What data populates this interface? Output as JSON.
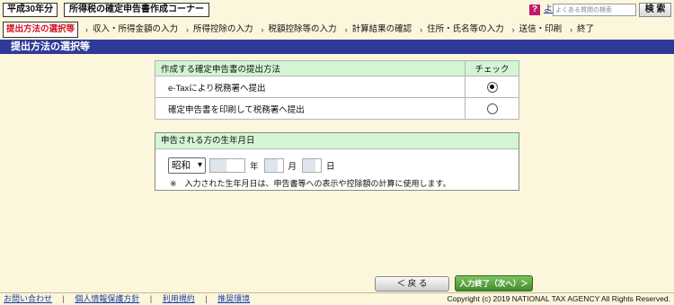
{
  "header": {
    "year_label": "平成30年分",
    "title": "所得税の確定申告書作成コーナー",
    "help_icon_glyph": "?",
    "faq_link": "よくある質問",
    "faq_search_placeholder": "よくある質問の検索",
    "search_button": "検 索"
  },
  "steps": [
    {
      "label": "提出方法の選択等",
      "current": true
    },
    {
      "label": "収入・所得金額の入力"
    },
    {
      "label": "所得控除の入力"
    },
    {
      "label": "税額控除等の入力"
    },
    {
      "label": "計算結果の確認"
    },
    {
      "label": "住所・氏名等の入力"
    },
    {
      "label": "送信・印刷"
    },
    {
      "label": "終了"
    }
  ],
  "section_title": "提出方法の選択等",
  "method_table": {
    "header_method": "作成する確定申告書の提出方法",
    "header_check": "チェック",
    "rows": [
      {
        "label": "e-Taxにより税務署へ提出",
        "selected": true
      },
      {
        "label": "確定申告書を印刷して税務署へ提出",
        "selected": false
      }
    ]
  },
  "birth": {
    "header": "申告される方の生年月日",
    "era_value": "昭和",
    "year_unit": "年",
    "month_unit": "月",
    "day_unit": "日",
    "note": "※　入力された生年月日は、申告書等への表示や控除額の計算に使用します。"
  },
  "buttons": {
    "back": "＜  戻 る",
    "next": "入力終了（次へ）＞"
  },
  "footer": {
    "links": [
      "お問い合わせ",
      "個人情報保護方針",
      "利用規約",
      "推奨環境"
    ],
    "copyright": "Copyright (c) 2019 NATIONAL TAX AGENCY All Rights Reserved."
  },
  "colors": {
    "background": "#fcf6dc",
    "section_bar": "#2f3a98",
    "table_header": "#d4f5d4",
    "current_step_text": "#d01020",
    "next_button": "#3f8a2a",
    "help_icon": "#c2186b"
  }
}
